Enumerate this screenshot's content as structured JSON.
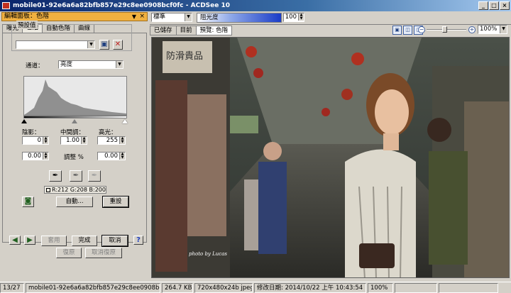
{
  "window": {
    "title": "mobile01-92e6a6a82bfb857e29c8ee0908bcf0fc - ACDSee 10",
    "controls": [
      "_",
      "□",
      "×"
    ]
  },
  "panel": {
    "title": "編輯面板：色階",
    "tabs": [
      "曝光",
      "色階",
      "自動色階",
      "曲線"
    ],
    "preset_label": "預設值",
    "preset_value": "",
    "channel_label": "通道：",
    "channel_value": "亮度",
    "shadow_label": "陰影：",
    "midtone_label": "中間調：",
    "highlight_label": "高光：",
    "shadow_value": "0",
    "midtone_value": "1.00",
    "highlight_value": "255",
    "out_low": "0.00",
    "out_high": "0.00",
    "adjust_label": "調整 %",
    "rgb_readout": "R:212 G:208 B:200",
    "auto_label": "自動...",
    "reset_label": "重設",
    "apply_label": "套用",
    "done_label": "完成",
    "cancel_label": "取消",
    "undo_label": "復原",
    "redo_label": "取消復原"
  },
  "toolbar": {
    "blend_mode": "標準",
    "opacity_label": "阻光度",
    "opacity_value": "100"
  },
  "view": {
    "tabs": [
      "已儲存",
      "目前",
      "預覽: 色階"
    ],
    "zoom": "100%"
  },
  "photo": {
    "credit": "photo by Lucas",
    "shop_sign": "防滑貴品"
  },
  "status": {
    "index": "13/27",
    "filename": "mobile01-92e6a6a82bfb857e29c8ee0908bcf0fc",
    "size": "264.7 KB",
    "dims": "720x480x24b jpeg",
    "modified": "修改日期: 2014/10/22 上午 10:43:54",
    "zoom": "100%"
  }
}
